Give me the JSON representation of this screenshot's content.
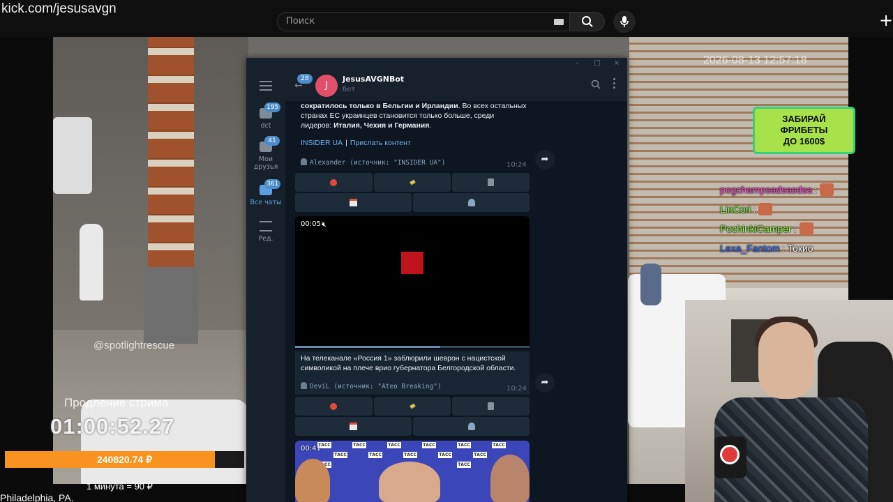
{
  "topbar": {
    "url": "kick.com/jesusavgn",
    "search_placeholder": "Поиск",
    "icons": [
      "keyboard-icon",
      "search-icon",
      "mic-icon",
      "plus-icon"
    ]
  },
  "stream": {
    "timestamp": "2026-08-13 12:57:18",
    "watermark": "@spotlightrescue",
    "promo": "ЗАБИРАЙ\nФРИБЕТЫ\nДО 1600$",
    "chat": [
      {
        "nick": "pogchampsadsasdsa",
        "color": "#ff4fd8",
        "sep": ":",
        "text": "",
        "emote": true
      },
      {
        "nick": "LinCori",
        "color": "#7dff4a",
        "sep": ":",
        "text": "",
        "emote": true
      },
      {
        "nick": "PochinkiCamper",
        "color": "#8cff4a",
        "sep": ":",
        "text": "",
        "emote": true
      },
      {
        "nick": "Lexa_Fantom",
        "color": "#3b6dff",
        "sep": ":",
        "text": "Токио",
        "emote": false
      }
    ],
    "extend_label": "Продление стрима",
    "timer": "01:00:52.27",
    "donation_total": "240820.74 ₽",
    "donation_progress": 0.877,
    "price_note": "1 минута = 90 ₽",
    "location": "Philadelphia, PA."
  },
  "telegram": {
    "sidebar": {
      "folders": [
        {
          "label": "dct",
          "badge": "195"
        },
        {
          "label": "Мои\nдрузья",
          "badge": "41"
        },
        {
          "label": "Все чаты",
          "badge": "361",
          "active": true
        },
        {
          "label": "Ред.",
          "badge": ""
        }
      ]
    },
    "header": {
      "back_badge": "28",
      "avatar_letter": "J",
      "name": "JesusAVGNBot",
      "status": "бот"
    },
    "messages": {
      "m1": {
        "line1_bold": "сократилось только в Бельгии и Ирландии",
        "line1_rest": ". Во всех остальных",
        "line2": "странах ЕС украинцев становится только больше, среди",
        "line3_pre": "лидеров: ",
        "line3_bold": "Италия, Чехия и Германия",
        "line3_post": ".",
        "link1": "INSIDER UA",
        "link_sep": "|",
        "link2": "Прислать контент",
        "signature": "Alexander (источник: \"INSIDER UA\")",
        "time": "10:24"
      },
      "video": {
        "time": "00:05",
        "progress": 0.62
      },
      "m2": {
        "line1": "На телеканале «Россия 1» заблюрили шеврон с нацистской",
        "line2": "символикой на плече врио губернатора Белгородской области.",
        "signature": "DeviL (источник: \"Ateo Breaking\")",
        "time": "10:24"
      },
      "video2": {
        "time": "00:41",
        "tile_text": "ТАСС"
      }
    }
  }
}
